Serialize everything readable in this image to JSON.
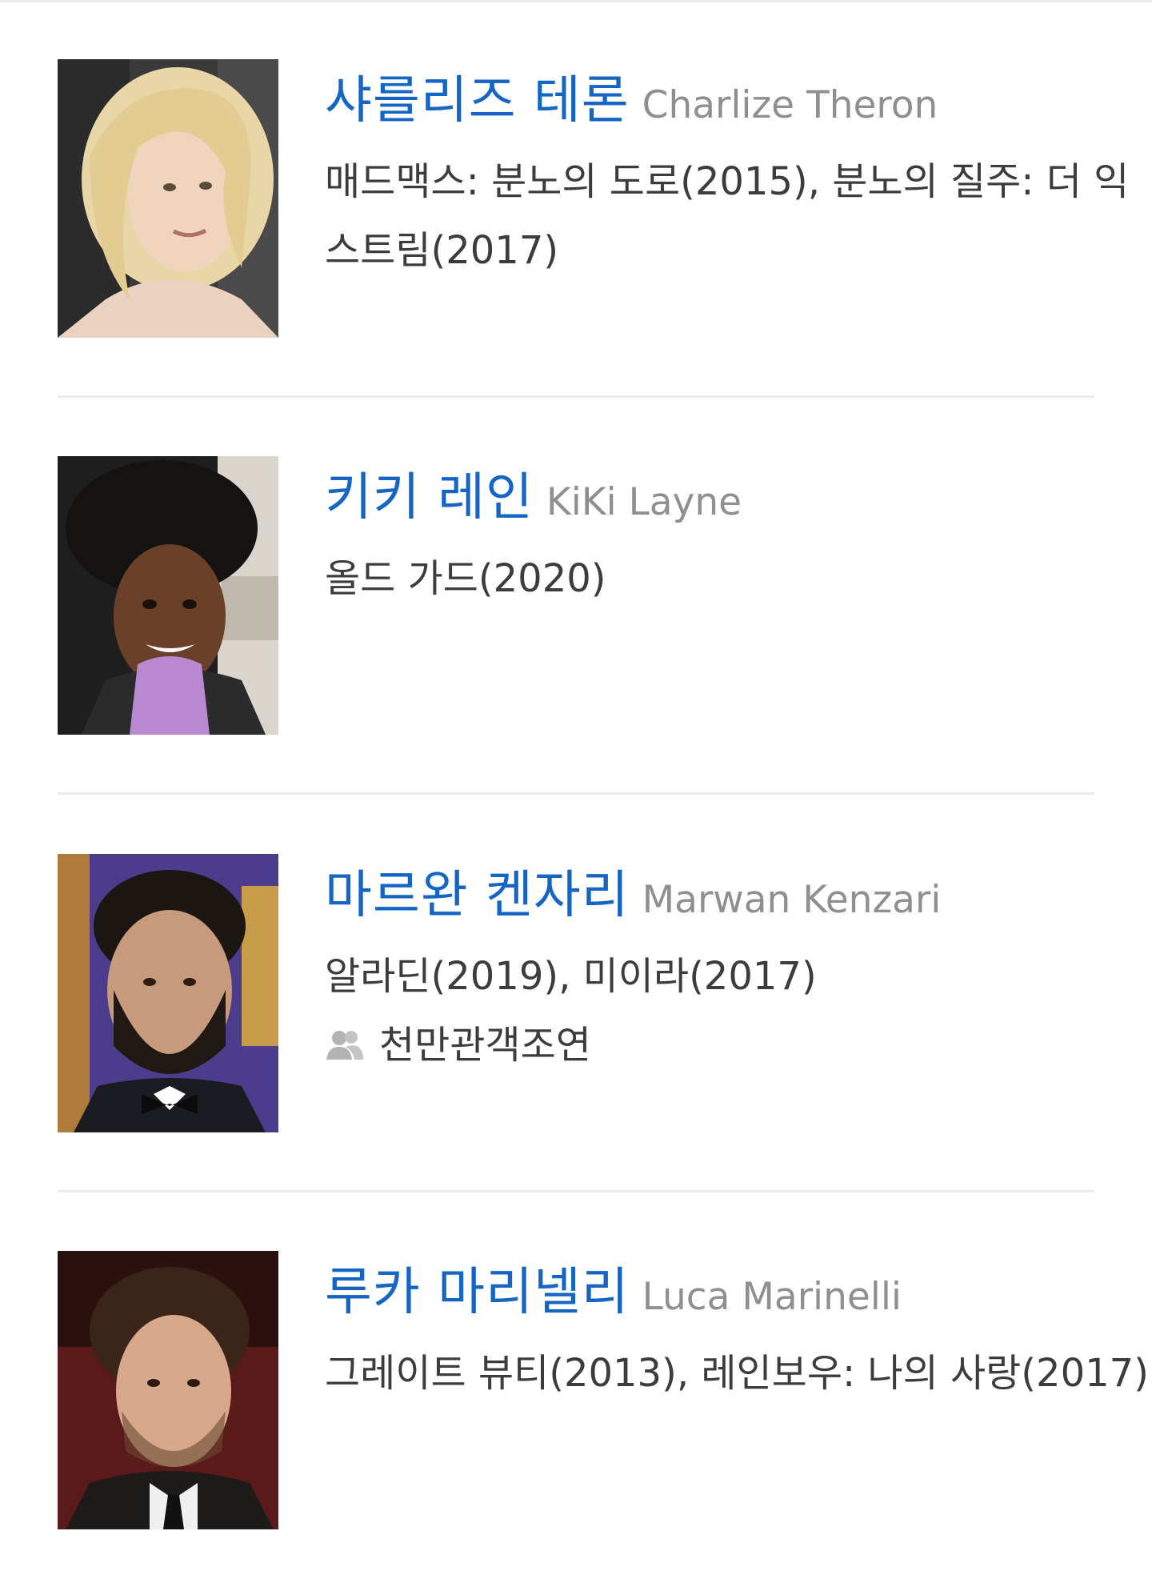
{
  "cast": [
    {
      "name_kr": "샤를리즈 테론",
      "name_en": "Charlize Theron",
      "films": "매드맥스: 분노의 도로(2015), 분노의 질주: 더 익스트림(2017)",
      "badge": ""
    },
    {
      "name_kr": "키키 레인",
      "name_en": "KiKi Layne",
      "films": "올드 가드(2020)",
      "badge": ""
    },
    {
      "name_kr": "마르완 켄자리",
      "name_en": "Marwan Kenzari",
      "films": "알라딘(2019), 미이라(2017)",
      "badge": "천만관객조연"
    },
    {
      "name_kr": "루카 마리넬리",
      "name_en": "Luca Marinelli",
      "films": "그레이트 뷰티(2013), 레인보우: 나의 사랑(2017)",
      "badge": ""
    }
  ],
  "colors": {
    "name_kr": "#1565c4",
    "name_en": "#8f8f8f",
    "body_text": "#3c3c3c",
    "divider": "#ebebeb"
  },
  "icons": {
    "badge": "people-icon"
  }
}
